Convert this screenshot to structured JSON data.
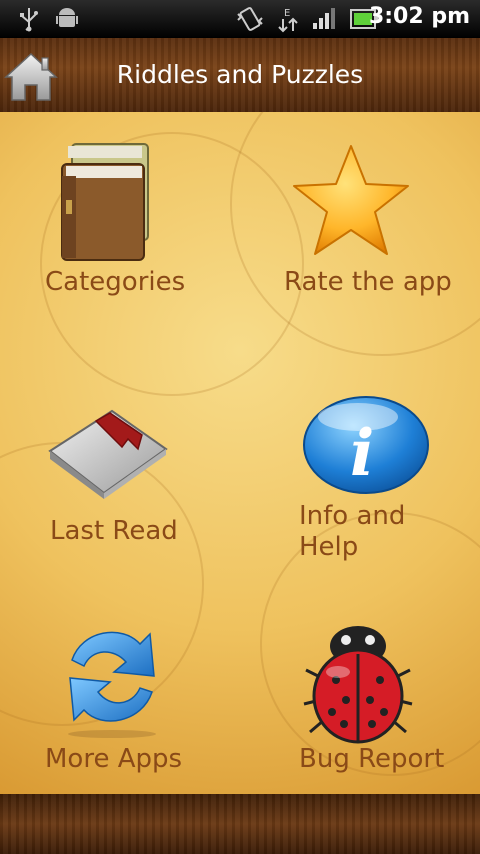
{
  "status_bar": {
    "time": "3:02 pm",
    "icons": [
      "usb-icon",
      "android-debug-icon",
      "vibrate-icon",
      "edge-data-icon",
      "signal-icon",
      "battery-icon"
    ],
    "network_label": "E"
  },
  "header": {
    "title": "Riddles and Puzzles",
    "home_icon": "home-icon"
  },
  "menu": {
    "items": [
      {
        "label": "Categories",
        "icon": "books-icon"
      },
      {
        "label": "Rate the app",
        "icon": "star-icon"
      },
      {
        "label": "Last Read",
        "icon": "bookmark-book-icon"
      },
      {
        "label": "Info and Help",
        "icon": "info-icon"
      },
      {
        "label": "More Apps",
        "icon": "refresh-arrows-icon"
      },
      {
        "label": "Bug Report",
        "icon": "ladybug-icon"
      }
    ]
  },
  "colors": {
    "label_text": "#8a4a17",
    "background": "#efc25e",
    "header_wood": "#7a4318"
  }
}
